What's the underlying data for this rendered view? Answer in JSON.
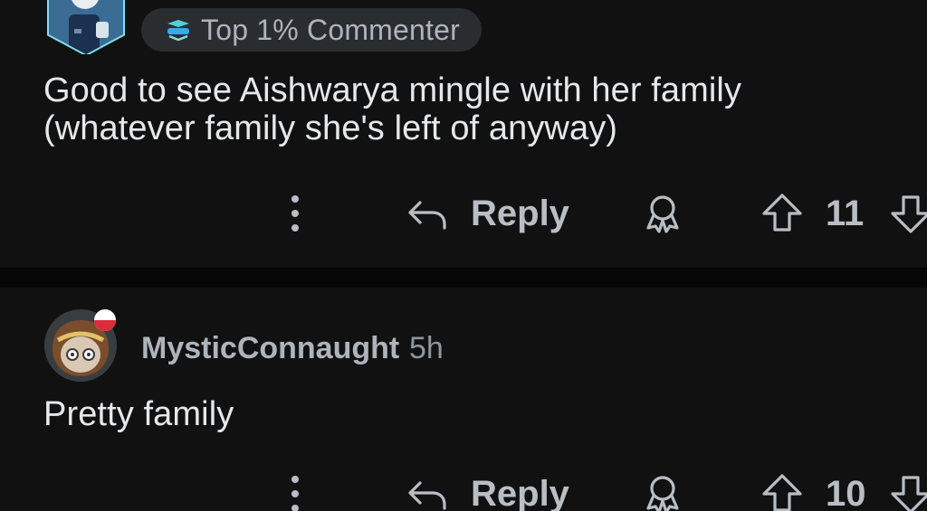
{
  "comments": [
    {
      "flair": {
        "icon": "top-commenter-icon",
        "text": "Top 1% Commenter"
      },
      "body_lines": [
        "Good to see Aishwarya mingle with her family",
        "(whatever family she's left of anyway)"
      ],
      "actions": {
        "reply_label": "Reply",
        "score": "11"
      }
    },
    {
      "username": "MysticConnaught",
      "timestamp": "5h",
      "body_lines": [
        "Pretty family"
      ],
      "actions": {
        "reply_label": "Reply",
        "score": "10"
      }
    }
  ],
  "icons": {
    "more": "more-vertical-icon",
    "reply": "reply-arrow-icon",
    "award": "award-icon",
    "upvote": "upvote-arrow-icon",
    "downvote": "downvote-arrow-icon"
  },
  "colors": {
    "background": "#111112",
    "divider": "#060606",
    "text": "#e6e8ea",
    "muted": "#b9bec4",
    "flair_bg": "#2a2d30"
  }
}
